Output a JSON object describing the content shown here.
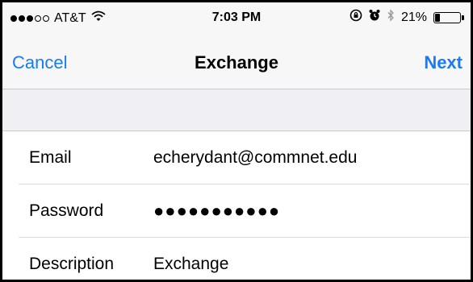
{
  "status_bar": {
    "carrier": "AT&T",
    "signal_filled": 3,
    "signal_total": 5,
    "time": "7:03 PM",
    "battery_percent": "21%",
    "battery_level": 0.21,
    "icons": [
      "wifi-icon",
      "rotation-lock-icon",
      "alarm-icon",
      "bluetooth-icon",
      "battery-icon"
    ]
  },
  "nav": {
    "cancel_label": "Cancel",
    "title": "Exchange",
    "next_label": "Next"
  },
  "form": {
    "email": {
      "label": "Email",
      "value": "echerydant@commnet.edu"
    },
    "password": {
      "label": "Password",
      "value": "●●●●●●●●●●●"
    },
    "description": {
      "label": "Description",
      "value": "Exchange"
    }
  },
  "colors": {
    "accent": "#1a7cf5",
    "section_background": "#efeff4"
  }
}
